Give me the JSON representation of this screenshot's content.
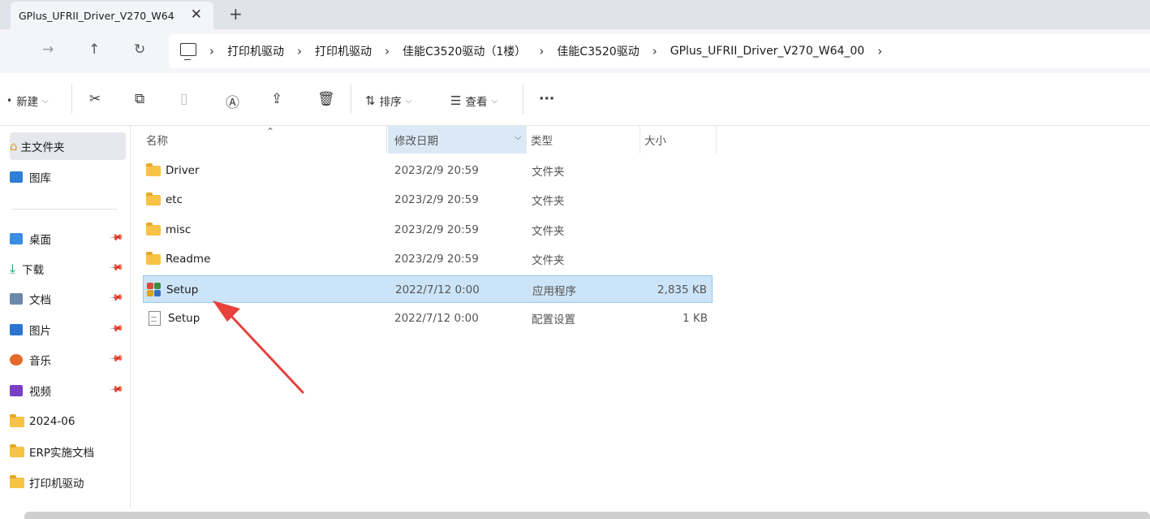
{
  "tab": {
    "title": "GPlus_UFRII_Driver_V270_W64",
    "close": "✕",
    "new": "+"
  },
  "nav": {
    "forward": "→",
    "up": "↑",
    "refresh": "↻"
  },
  "breadcrumb": [
    "打印机驱动",
    "打印机驱动",
    "佳能C3520驱动（1楼）",
    "佳能C3520驱动",
    "GPlus_UFRII_Driver_V270_W64_00"
  ],
  "toolbar": {
    "new_label": "新建",
    "sort_label": "排序",
    "view_label": "查看",
    "more_label": "···"
  },
  "sidebar": {
    "items": [
      {
        "label": "主文件夹",
        "color": "#e39a2d"
      },
      {
        "label": "图库",
        "color": "#2f7fd6"
      },
      {
        "label": "桌面",
        "color": "#3a8de0"
      },
      {
        "label": "下载",
        "color": "#1e9a6a"
      },
      {
        "label": "文档",
        "color": "#6d87a8"
      },
      {
        "label": "图片",
        "color": "#2a74d0"
      },
      {
        "label": "音乐",
        "color": "#e56a2b"
      },
      {
        "label": "视频",
        "color": "#7b3fc4"
      },
      {
        "label": "2024-06",
        "color": "#f7c344"
      },
      {
        "label": "ERP实施文档",
        "color": "#f7c344"
      },
      {
        "label": "打印机驱动",
        "color": "#f7c344"
      }
    ]
  },
  "columns": {
    "name": "名称",
    "date": "修改日期",
    "type": "类型",
    "size": "大小"
  },
  "files": [
    {
      "name": "Driver",
      "date": "2023/2/9 20:59",
      "type": "文件夹",
      "size": "",
      "icon": "folder-icon"
    },
    {
      "name": "etc",
      "date": "2023/2/9 20:59",
      "type": "文件夹",
      "size": "",
      "icon": "folder-icon"
    },
    {
      "name": "misc",
      "date": "2023/2/9 20:59",
      "type": "文件夹",
      "size": "",
      "icon": "folder-icon"
    },
    {
      "name": "Readme",
      "date": "2023/2/9 20:59",
      "type": "文件夹",
      "size": "",
      "icon": "folder-icon"
    },
    {
      "name": "Setup",
      "date": "2022/7/12 0:00",
      "type": "应用程序",
      "size": "2,835 KB",
      "icon": "setup-exe-icon"
    },
    {
      "name": "Setup",
      "date": "2022/7/12 0:00",
      "type": "配置设置",
      "size": "1 KB",
      "icon": "config-file-icon"
    }
  ],
  "colors": {
    "selection": "#cce4f7",
    "arrow": "#e8413c",
    "folder": "#f7c344"
  }
}
